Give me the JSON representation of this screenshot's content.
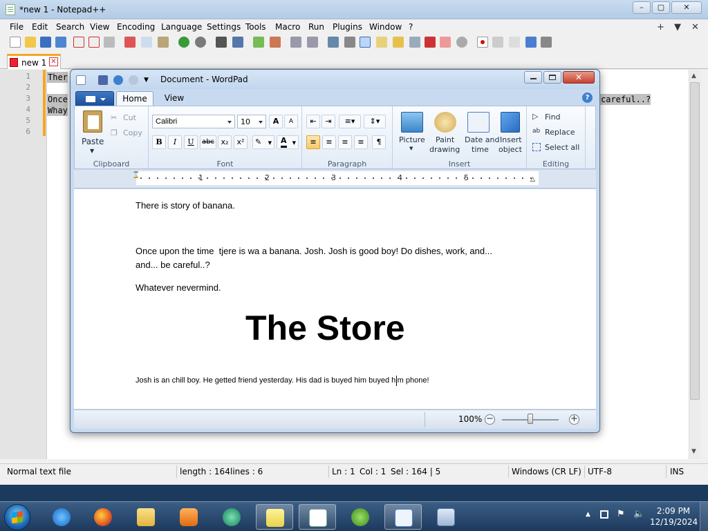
{
  "npp": {
    "title": "*new 1 - Notepad++",
    "menu": [
      "File",
      "Edit",
      "Search",
      "View",
      "Encoding",
      "Language",
      "Settings",
      "Tools",
      "Macro",
      "Run",
      "Plugins",
      "Window",
      "?"
    ],
    "menu_right": [
      "+",
      "▼",
      "✕"
    ],
    "tab_label": "new 1",
    "line_numbers": [
      "1",
      "2",
      "3",
      "4",
      "5",
      "6"
    ],
    "lines": {
      "l1": "Ther",
      "l3": "Once",
      "l3_right": "careful..?",
      "l4": "Whay"
    },
    "status": {
      "type": "Normal text file",
      "length": "length : 164",
      "lines": "lines : 6",
      "ln": "Ln : 1",
      "col": "Col : 1",
      "sel": "Sel : 164 | 5",
      "eol": "Windows (CR LF)",
      "enc": "UTF-8",
      "mode": "INS"
    }
  },
  "wordpad": {
    "title": "Document - WordPad",
    "tabs": {
      "home": "Home",
      "view": "View"
    },
    "help": "?",
    "clipboard": {
      "paste": "Paste",
      "cut": "Cut",
      "copy": "Copy",
      "group": "Clipboard"
    },
    "font": {
      "family": "Calibri",
      "size": "10",
      "group": "Font",
      "bold": "B",
      "italic": "I",
      "underline": "U",
      "strike": "abc",
      "sub": "x₂",
      "sup": "x²",
      "grow": "A",
      "shrink": "A",
      "color": "A"
    },
    "paragraph": {
      "group": "Paragraph"
    },
    "insert": {
      "picture": "Picture",
      "paint1": "Paint",
      "paint2": "drawing",
      "dt1": "Date and",
      "dt2": "time",
      "obj1": "Insert",
      "obj2": "object",
      "group": "Insert"
    },
    "editing": {
      "find": "Find",
      "replace": "Replace",
      "select_all": "Select all",
      "group": "Editing"
    },
    "ruler": [
      "1",
      "2",
      "3",
      "4",
      "5"
    ],
    "doc": {
      "p1": "There is story of banana.",
      "p2": "Once upon the time  tjere is wa a banana. Josh. Josh is good boy! Do dishes, work, and...",
      "p3": "and... be careful..?",
      "p4": "Whatever nevermind.",
      "heading": "The Store",
      "p5": "Josh is an chill boy. He getted friend yesterday. His dad is buyed him buyed him phone!"
    },
    "zoom": "100%",
    "zoom_level_percent": 100
  },
  "taskbar": {
    "apps": [
      "internet-explorer",
      "firefox",
      "file-explorer",
      "media-player",
      "app-green",
      "sticky-notes",
      "notepad-plus-plus",
      "frog-app",
      "wordpad",
      "remote-desktop"
    ],
    "time": "2:09 PM",
    "date": "12/19/2024"
  },
  "colors": {
    "accent": "#f5a623",
    "selection": "#c0c0c0",
    "ribbon_blue": "#1d4f9b",
    "close_red": "#c7402e"
  }
}
